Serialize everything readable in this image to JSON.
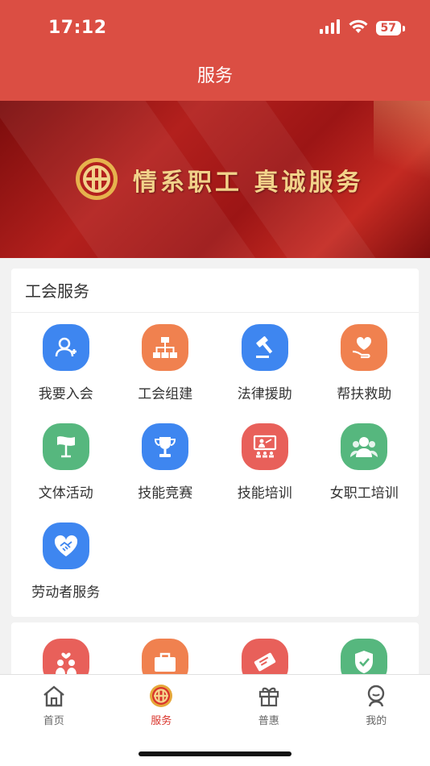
{
  "status_bar": {
    "time": "17:12",
    "battery": "57"
  },
  "header": {
    "title": "服务"
  },
  "banner": {
    "slogan": "情系职工 真诚服务"
  },
  "union_services": {
    "title": "工会服务",
    "items": [
      {
        "label": "我要入会",
        "icon": "add-user-icon",
        "color": "#3e86f0"
      },
      {
        "label": "工会组建",
        "icon": "org-chart-icon",
        "color": "#f0814f"
      },
      {
        "label": "法律援助",
        "icon": "gavel-icon",
        "color": "#3e86f0"
      },
      {
        "label": "帮扶救助",
        "icon": "heart-hand-icon",
        "color": "#f0814f"
      },
      {
        "label": "文体活动",
        "icon": "flag-icon",
        "color": "#56b77e"
      },
      {
        "label": "技能竞赛",
        "icon": "trophy-icon",
        "color": "#3e86f0"
      },
      {
        "label": "技能培训",
        "icon": "classroom-icon",
        "color": "#e8605a"
      },
      {
        "label": "女职工培训",
        "icon": "women-group-icon",
        "color": "#56b77e"
      },
      {
        "label": "劳动者服务",
        "icon": "handshake-icon",
        "color": "#3e86f0"
      }
    ]
  },
  "second_services": {
    "items": [
      {
        "icon": "couple-icon",
        "color": "#e8605a"
      },
      {
        "icon": "briefcase-icon",
        "color": "#f0814f"
      },
      {
        "icon": "ticket-icon",
        "color": "#e8605a"
      },
      {
        "icon": "shield-check-icon",
        "color": "#56b77e"
      }
    ]
  },
  "tab_bar": {
    "tabs": [
      {
        "label": "首页",
        "icon": "home-icon",
        "active": false
      },
      {
        "label": "服务",
        "icon": "union-logo-icon",
        "active": true
      },
      {
        "label": "普惠",
        "icon": "gift-icon",
        "active": false
      },
      {
        "label": "我的",
        "icon": "profile-icon",
        "active": false
      }
    ]
  },
  "colors": {
    "brand_red": "#db4e43",
    "active_tab": "#d9342b"
  }
}
